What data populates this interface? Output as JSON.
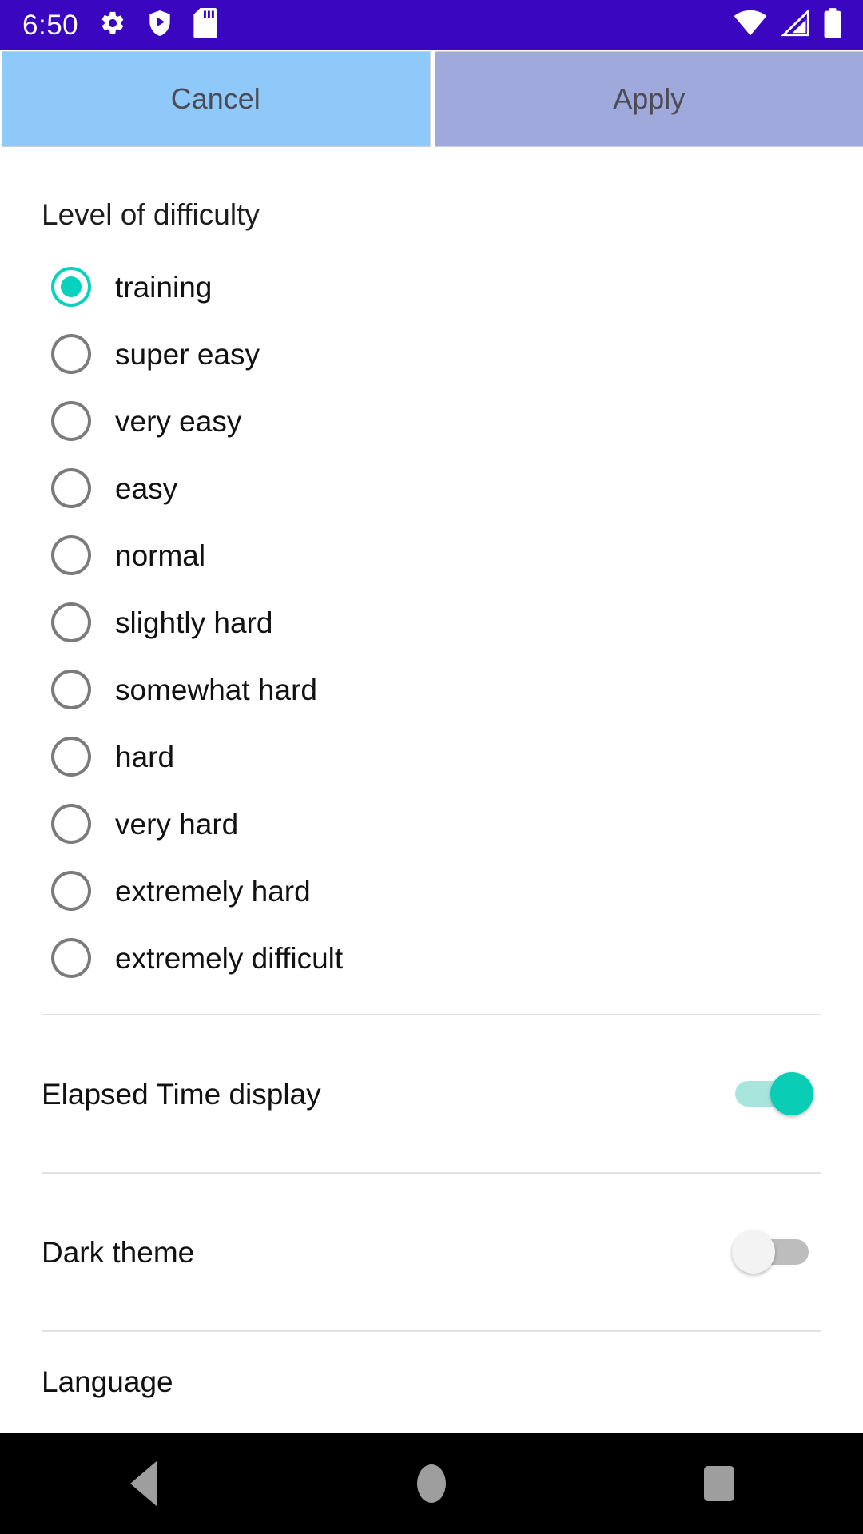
{
  "status_bar": {
    "time": "6:50",
    "background_color": "#3A06C0",
    "left_icons": [
      "gear-icon",
      "shield-play-icon",
      "sd-card-icon"
    ],
    "right_icons": [
      "wifi-icon",
      "cellular-signal-icon",
      "battery-icon"
    ]
  },
  "action_bar": {
    "cancel_label": "Cancel",
    "apply_label": "Apply",
    "cancel_color": "#8FC9FA",
    "apply_color": "#9FA9DC"
  },
  "settings": {
    "difficulty_title": "Level of difficulty",
    "accent_color": "#08D2BE",
    "options": [
      {
        "label": "training",
        "selected": true
      },
      {
        "label": "super easy",
        "selected": false
      },
      {
        "label": "very easy",
        "selected": false
      },
      {
        "label": "easy",
        "selected": false
      },
      {
        "label": "normal",
        "selected": false
      },
      {
        "label": "slightly hard",
        "selected": false
      },
      {
        "label": "somewhat hard",
        "selected": false
      },
      {
        "label": "hard",
        "selected": false
      },
      {
        "label": "very hard",
        "selected": false
      },
      {
        "label": "extremely hard",
        "selected": false
      },
      {
        "label": "extremely difficult",
        "selected": false
      }
    ],
    "elapsed_time": {
      "label": "Elapsed Time display",
      "enabled": true
    },
    "dark_theme": {
      "label": "Dark theme",
      "enabled": false
    },
    "language": {
      "label": "Language"
    }
  },
  "nav_bar": {
    "back_label": "Back",
    "home_label": "Home",
    "recents_label": "Recents"
  }
}
